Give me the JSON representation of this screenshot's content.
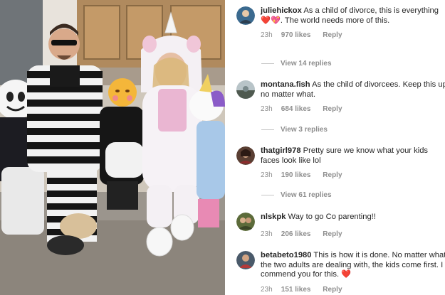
{
  "comments": [
    {
      "username": "juliehickox",
      "text": " As a child of divorce, this is everything ",
      "emoji1": "❤️",
      "emoji2": "💖",
      "text2": ". The world needs more of this.",
      "time": "23h",
      "likes": "970 likes",
      "reply": "Reply",
      "view_replies": "View 14 replies",
      "avatar_color": "#3b6a8f"
    },
    {
      "username": "montana.fish",
      "text": " As the child of divorcees. Keep this up no matter what.",
      "time": "23h",
      "likes": "684 likes",
      "reply": "Reply",
      "view_replies": "View 3 replies",
      "avatar_color": "#7a8a8c"
    },
    {
      "username": "thatgirl978",
      "text": " Pretty sure we know what your kids faces look like lol",
      "time": "23h",
      "likes": "190 likes",
      "reply": "Reply",
      "view_replies": "View 61 replies",
      "avatar_color": "#6b4a3d"
    },
    {
      "username": "nlskpk",
      "text": " Way to go Co parenting!!",
      "time": "23h",
      "likes": "206 likes",
      "reply": "Reply",
      "avatar_color": "#5c6b3a"
    },
    {
      "username": "betabeto1980",
      "text": " This is how it is done. No matter what the two adults are dealing with, the kids come first. I commend you for this. ",
      "emoji1": "❤️",
      "time": "23h",
      "likes": "151 likes",
      "reply": "Reply",
      "avatar_color": "#4a5a6a"
    }
  ],
  "colors": {
    "text": "#262626",
    "meta": "#8e8e8e",
    "heart": "#ed4956"
  }
}
